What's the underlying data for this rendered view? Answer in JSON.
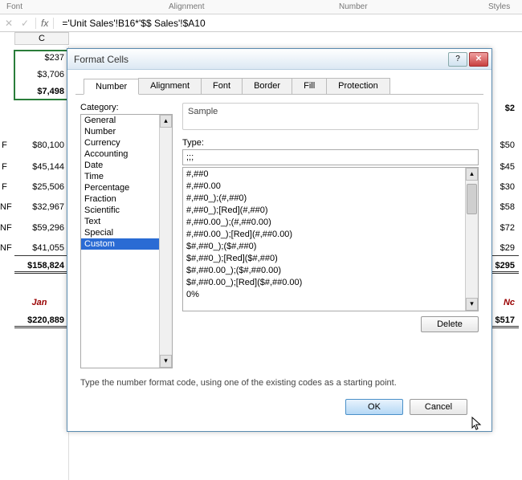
{
  "ribbon": {
    "font": "Font",
    "alignment": "Alignment",
    "number": "Number",
    "styles": "Styles"
  },
  "formula_bar": {
    "fx": "fx",
    "value": "='Unit Sales'!B16*'$$ Sales'!$A10"
  },
  "columns": {
    "C": "C"
  },
  "left_col": {
    "r1": "$237",
    "r2": "$3,706",
    "r3": "$7,498",
    "nf1_label": "F",
    "nf1": "$80,100",
    "nf2_label": "F",
    "nf2": "$45,144",
    "nf3_label": "F",
    "nf3": "$25,506",
    "nf4_label": "NF",
    "nf4": "$32,967",
    "nf5_label": "NF",
    "nf5": "$59,296",
    "nf6_label": "NF",
    "nf6": "$41,055",
    "total1": "$158,824",
    "jan": "Jan",
    "total2": "$220,889"
  },
  "right_col": {
    "r1": "$2",
    "v1": "$50",
    "v2": "$45",
    "v3": "$30",
    "v4": "$58",
    "v5": "$72",
    "v6": "$29",
    "t1": "$295",
    "nc": "Nc",
    "t2": "$517"
  },
  "dialog": {
    "title": "Format Cells",
    "help": "?",
    "close": "✕",
    "tabs": [
      "Number",
      "Alignment",
      "Font",
      "Border",
      "Fill",
      "Protection"
    ],
    "category_label": "Category:",
    "categories": [
      "General",
      "Number",
      "Currency",
      "Accounting",
      "Date",
      "Time",
      "Percentage",
      "Fraction",
      "Scientific",
      "Text",
      "Special",
      "Custom"
    ],
    "selected_category_index": 11,
    "sample_label": "Sample",
    "type_label": "Type:",
    "type_value": ";;;",
    "formats": [
      "#,##0",
      "#,##0.00",
      "#,##0_);(#,##0)",
      "#,##0_);[Red](#,##0)",
      "#,##0.00_);(#,##0.00)",
      "#,##0.00_);[Red](#,##0.00)",
      "$#,##0_);($#,##0)",
      "$#,##0_);[Red]($#,##0)",
      "$#,##0.00_);($#,##0.00)",
      "$#,##0.00_);[Red]($#,##0.00)",
      "0%"
    ],
    "delete": "Delete",
    "hint": "Type the number format code, using one of the existing codes as a starting point.",
    "ok": "OK",
    "cancel": "Cancel"
  }
}
